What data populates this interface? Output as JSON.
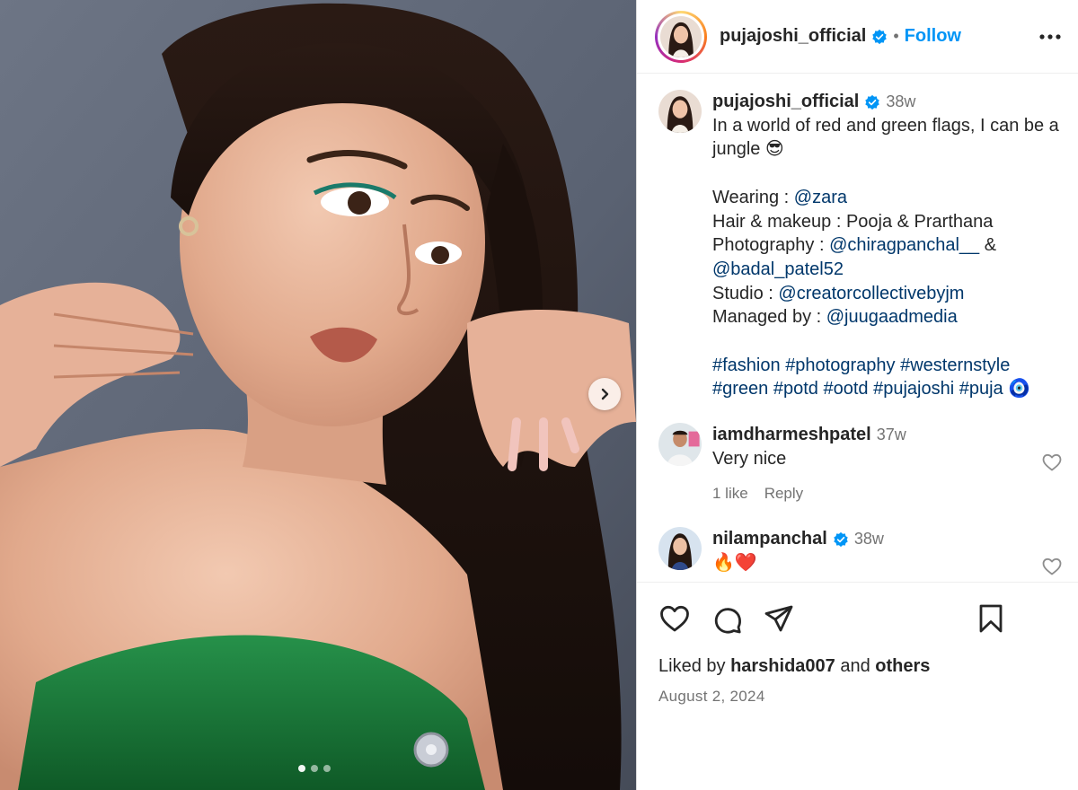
{
  "post": {
    "username": "pujajoshi_official",
    "follow_label": "Follow",
    "separator": "•",
    "carousel": {
      "slides": 3,
      "active_index": 0
    }
  },
  "caption": {
    "username": "pujajoshi_official",
    "time": "38w",
    "line1": "In a world of red and green flags, I can be a jungle 😎",
    "wearing_prefix": "Wearing : ",
    "wearing_link": "@zara",
    "hair_makeup": "Hair & makeup : Pooja & Prarthana",
    "photography_prefix": "Photography : ",
    "photography_link1": "@chiragpanchal__",
    "photography_amp": " & ",
    "photography_link2": "@badal_patel52",
    "studio_prefix": "Studio : ",
    "studio_link": "@creatorcollectivebyjm",
    "managed_prefix": "Managed by : ",
    "managed_link": "@juugaadmedia",
    "hashtags": [
      "#fashion",
      "#photography",
      "#westernstyle",
      "#green",
      "#potd",
      "#ootd",
      "#pujajoshi",
      "#puja"
    ],
    "nazar_emoji": "🧿"
  },
  "comments": [
    {
      "username": "iamdharmeshpatel",
      "time": "37w",
      "text": "Very nice",
      "likes_label": "1 like",
      "reply_label": "Reply"
    },
    {
      "username": "nilampanchal",
      "time": "38w",
      "text": "🔥❤️",
      "verified": true
    }
  ],
  "footer": {
    "liked_by_prefix": "Liked by ",
    "liked_by_user": "harshida007",
    "liked_by_and": " and ",
    "liked_by_others": "others",
    "date": "August 2, 2024"
  },
  "colors": {
    "accent": "#0095f6",
    "link": "#00376b",
    "muted": "#737373",
    "dress": "#1e7a3a"
  },
  "icons": [
    "verified-badge-icon",
    "more-options-icon",
    "chevron-right-icon",
    "heart-icon",
    "comment-icon",
    "share-icon",
    "bookmark-icon"
  ]
}
